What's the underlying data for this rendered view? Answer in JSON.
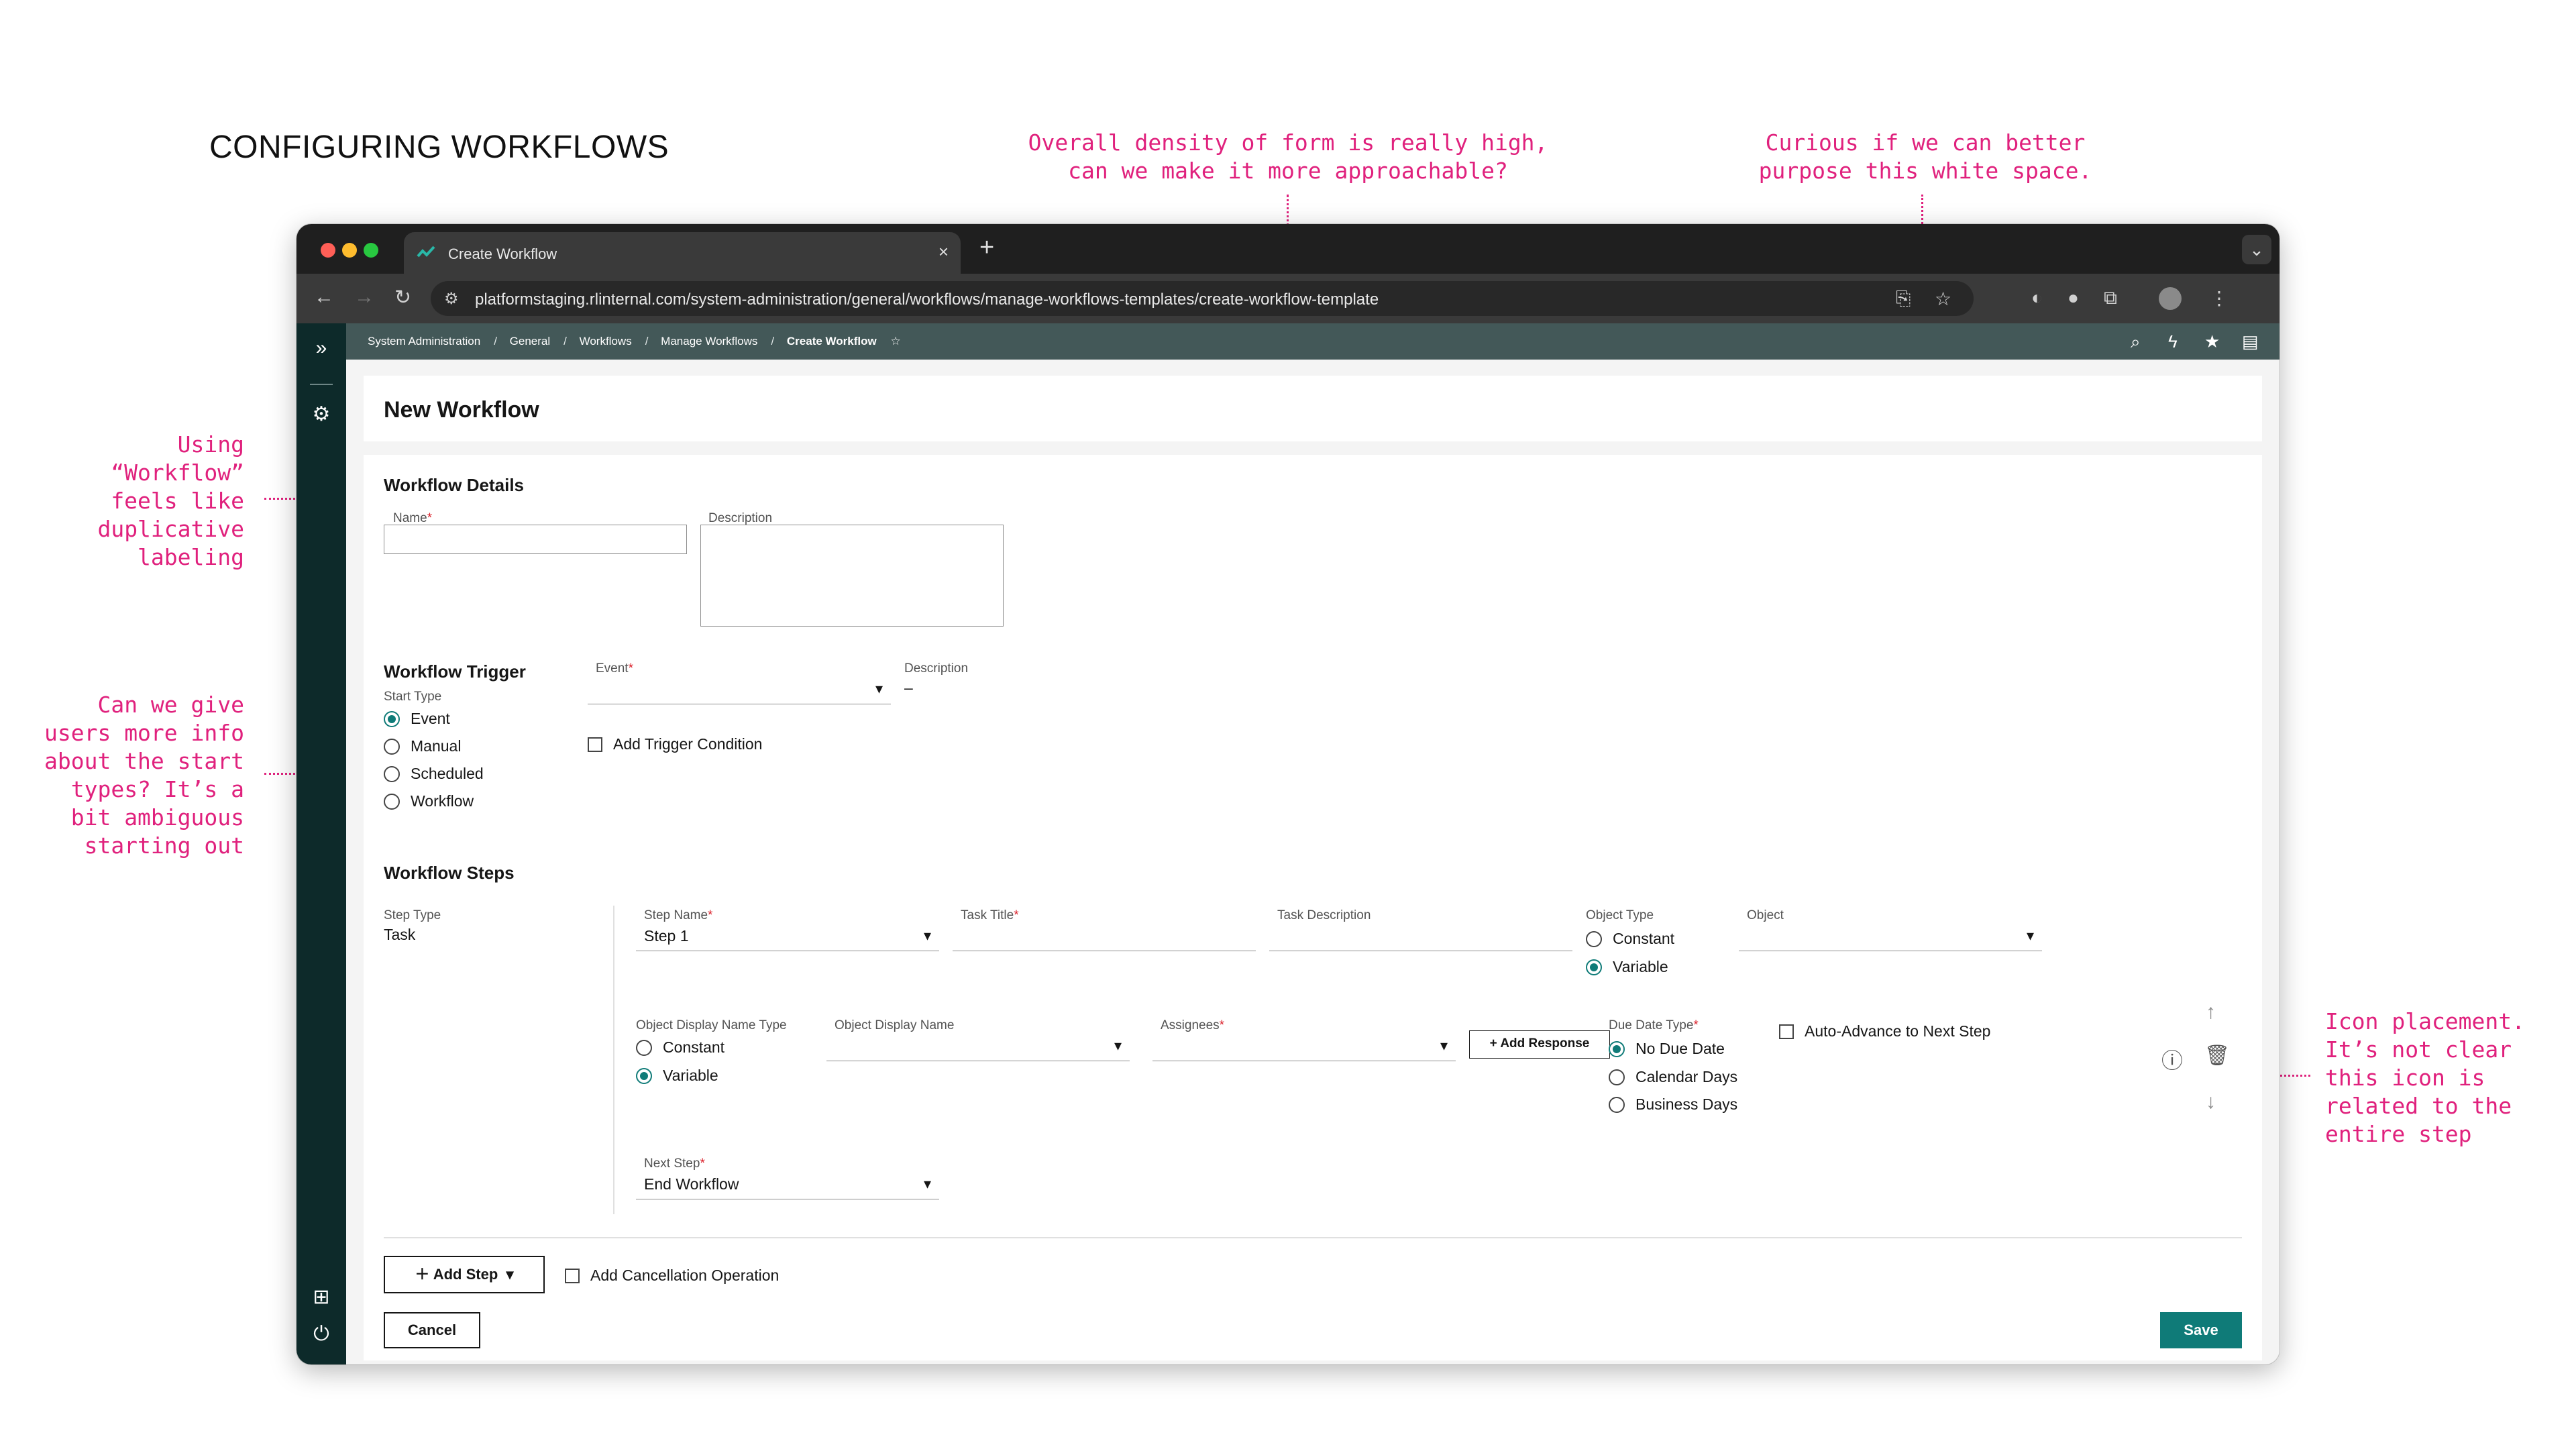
{
  "heading": "CONFIGURING WORKFLOWS",
  "annotations": {
    "density": "Overall density of form is really high,\ncan we make it more approachable?",
    "whitespace": "Curious if we can better\npurpose this white space.",
    "labeling": "Using\n“Workflow”\nfeels like\nduplicative\nlabeling",
    "start_types": "Can we give\nusers more info\nabout the start\ntypes? It’s a\nbit ambiguous\nstarting out",
    "icon_placement": "Icon placement.\nIt’s not clear\nthis icon is\nrelated to the\nentire step"
  },
  "browser": {
    "tab_title": "Create Workflow",
    "tab_close": "×",
    "new_tab": "+",
    "url": "platformstaging.rlinternal.com/system-administration/general/workflows/manage-workflows-templates/create-workflow-template",
    "colors": {
      "red": "#ff5f57",
      "yellow": "#febc2e",
      "green": "#28c840"
    }
  },
  "breadcrumbs": {
    "items": [
      "System Administration",
      "General",
      "Workflows",
      "Manage Workflows"
    ],
    "current": "Create Workflow",
    "separator": "/"
  },
  "page_title": "New Workflow",
  "details": {
    "title": "Workflow Details",
    "name_label": "Name",
    "description_label": "Description",
    "required_mark": "*"
  },
  "trigger": {
    "title": "Workflow Trigger",
    "start_type_label": "Start Type",
    "options": [
      "Event",
      "Manual",
      "Scheduled",
      "Workflow"
    ],
    "selected": "Event",
    "event_label": "Event",
    "description_label": "Description",
    "description_value": "–",
    "add_condition": "Add Trigger Condition"
  },
  "steps": {
    "title": "Workflow Steps",
    "step_type_label": "Step Type",
    "step_type_value": "Task",
    "step_name_label": "Step Name",
    "step_name_value": "Step 1",
    "task_title_label": "Task Title",
    "task_description_label": "Task Description",
    "object_type_label": "Object Type",
    "object_type_options": [
      "Constant",
      "Variable"
    ],
    "object_type_selected": "Variable",
    "object_label": "Object",
    "display_name_type_label": "Object Display Name Type",
    "display_name_type_options": [
      "Constant",
      "Variable"
    ],
    "display_name_type_selected": "Variable",
    "display_name_label": "Object Display Name",
    "assignees_label": "Assignees",
    "add_response": "Add Response",
    "due_date_label": "Due Date Type",
    "due_date_options": [
      "No Due Date",
      "Calendar Days",
      "Business Days"
    ],
    "due_date_selected": "No Due Date",
    "auto_advance": "Auto-Advance to Next Step",
    "next_step_label": "Next Step",
    "next_step_value": "End Workflow"
  },
  "footer": {
    "add_step": "Add Step",
    "add_cancellation": "Add Cancellation Operation",
    "cancel": "Cancel",
    "save": "Save"
  },
  "colors": {
    "accent": "#0f7b78",
    "annotation": "#e0217d",
    "nav": "#0d2a2a",
    "strip": "#435858"
  }
}
